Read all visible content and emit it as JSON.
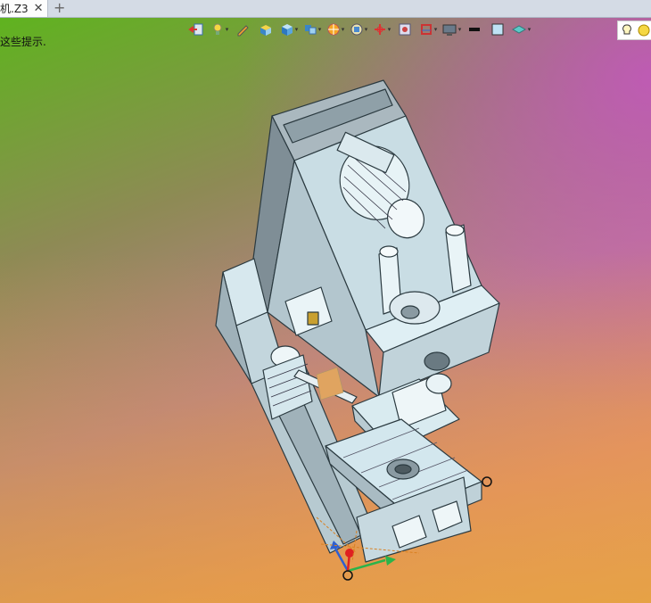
{
  "tab": {
    "title": "机.Z3",
    "close": "✕",
    "add": "+"
  },
  "hint": "这些提示.",
  "toolbar": {
    "icons": [
      "exit-view-icon",
      "light-bulb-filter-icon",
      "pencil-icon",
      "box-solid-icon",
      "cube-view-icon",
      "multi-view-icon",
      "render-mode-icon",
      "section-icon",
      "axis-icon",
      "zoom-icon",
      "layers-icon",
      "display-icon",
      "line-color-icon",
      "fill-color-icon",
      "shading-icon",
      "light-icon"
    ]
  },
  "colors": {
    "accent": "#3a6fb0",
    "model_fill": "#cde3ea",
    "model_line": "#2b3a40"
  }
}
